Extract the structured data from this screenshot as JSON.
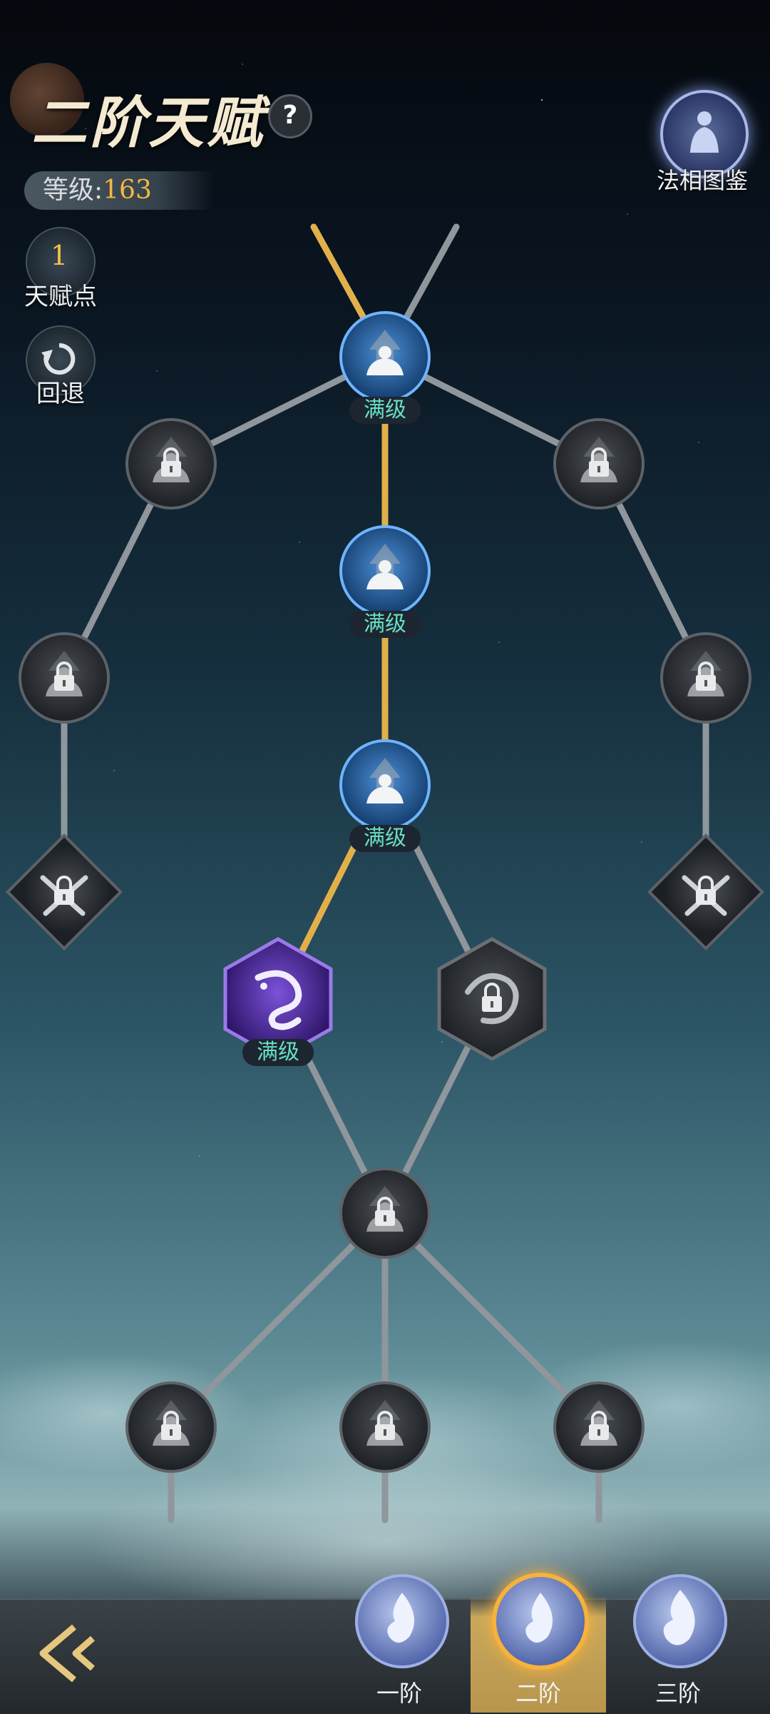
{
  "header": {
    "title": "二阶天赋",
    "help_symbol": "?",
    "level_label": "等级:",
    "level_value": "163"
  },
  "side": {
    "talent_points_value": "1",
    "talent_points_label": "天赋点",
    "undo_label": "回退"
  },
  "codex": {
    "label": "法相图鉴"
  },
  "tree": {
    "max_label": "满级"
  },
  "tabs": [
    {
      "label": "一阶",
      "active": false
    },
    {
      "label": "二阶",
      "active": true
    },
    {
      "label": "三阶",
      "active": false
    }
  ],
  "colors": {
    "active_path": "#e2b04a",
    "inactive_path": "#8f969c",
    "max_tag_text": "#66e0c4",
    "level_value": "#f3b843",
    "accent_tab": "#c9a85c"
  },
  "icons": [
    "question-icon",
    "undo-icon",
    "codex-icon",
    "bodhisattva-icon",
    "lock-icon",
    "sword-icon",
    "dragon-icon",
    "phoenix-icon",
    "back-arrow-icon",
    "flame-icon"
  ]
}
